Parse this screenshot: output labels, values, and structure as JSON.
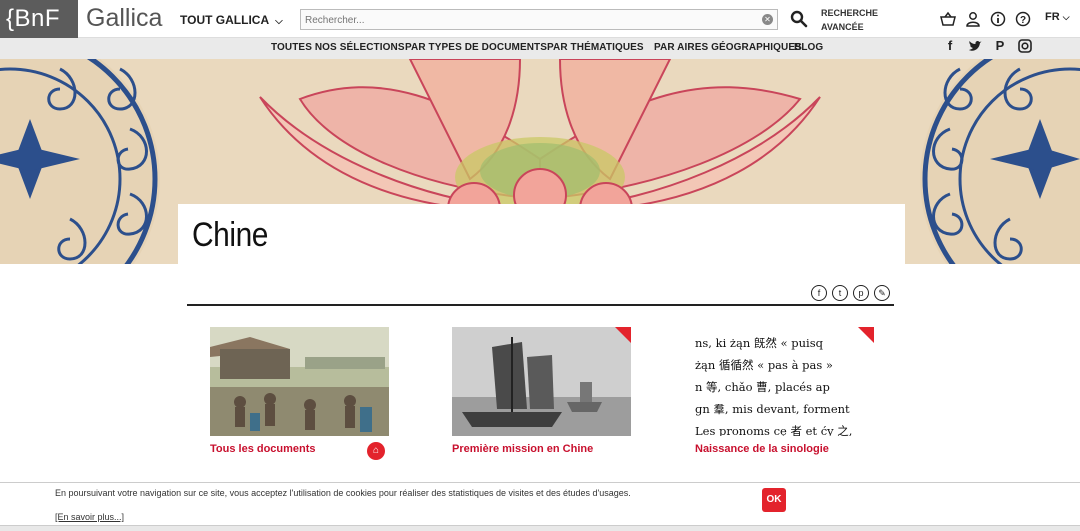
{
  "header": {
    "logo_bnf": "{BnF",
    "logo_gallica": "Gallica",
    "collection_selector": "TOUT GALLICA",
    "search_placeholder": "Rechercher...",
    "advanced_search": "RECHERCHE AVANCÉE",
    "language": "FR"
  },
  "nav": {
    "items": [
      "TOUTES NOS SÉLECTIONS",
      "PAR TYPES DE DOCUMENTS",
      "PAR THÉMATIQUES",
      "PAR AIRES GÉOGRAPHIQUES",
      "BLOG"
    ]
  },
  "page": {
    "title": "Chine"
  },
  "cards": [
    {
      "label": "Tous les documents"
    },
    {
      "label": "Première mission en Chine"
    },
    {
      "label": "Naissance de la sinologie"
    }
  ],
  "sinology_text": [
    "ns, ki żąn 旣然 « puisq",
    "żąn 循循然 « pas à pas »",
    "n 等, chǎo 曹, placés ap",
    "ɡn 羣, mis devant, forment",
    "Les pronoms cḙ 者 et ćy 之,"
  ],
  "cookie": {
    "message": "En poursuivant votre navigation sur ce site, vous acceptez l'utilisation de cookies pour réaliser des statistiques de visites et des études d'usages.",
    "more": "[En savoir plus...]",
    "ok": "OK"
  },
  "colors": {
    "accent": "#e3232c",
    "logo_bg": "#5c5c5c",
    "nav_bg": "#eaeaea"
  }
}
